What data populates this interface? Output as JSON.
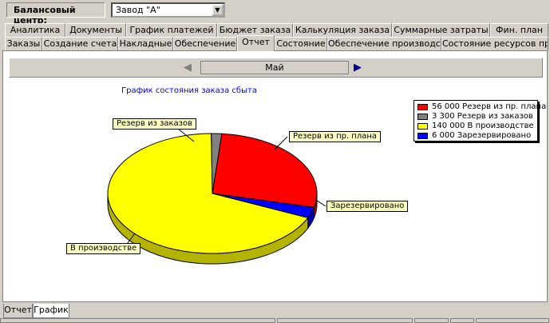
{
  "header": {
    "balance_center_label": "Балансовый центр:",
    "balance_center_value": "Завод \"А\""
  },
  "tabs_row1": [
    "Аналитика",
    "Документы",
    "График платежей",
    "Бюджет заказа",
    "Калькуляция заказа",
    "Суммарные затраты",
    "Фин. план"
  ],
  "tabs_row2": [
    "Заказы",
    "Создание счета",
    "Накладные",
    "Обеспечение",
    "Отчет",
    "Состояние",
    "Обеспечение производства",
    "Состояние ресурсов пр-ва"
  ],
  "active_tab": "Отчет",
  "nav": {
    "month": "Май",
    "prev_icon": "arrow-left-icon",
    "next_icon": "arrow-right-icon"
  },
  "chart_data": {
    "type": "pie",
    "title": "График состояния заказа сбыта",
    "slices": [
      {
        "label": "Резерв из пр. плана",
        "value": 56000,
        "color": "#ff0000"
      },
      {
        "label": "Зарезервировано",
        "value": 6000,
        "color": "#0000ff"
      },
      {
        "label": "В производстве",
        "value": 140000,
        "color": "#ffff00"
      },
      {
        "label": "Резерв из заказов",
        "value": 3300,
        "color": "#808080"
      }
    ],
    "legend": [
      {
        "text": "56 000 Резерв из пр. плана",
        "color": "#ff0000"
      },
      {
        "text": "3 300 Резерв из заказов",
        "color": "#808080"
      },
      {
        "text": "140 000 В производстве",
        "color": "#ffff00"
      },
      {
        "text": "6 000 Зарезервировано",
        "color": "#0000ff"
      }
    ],
    "legend_position": "top-right",
    "three_d": true
  },
  "bottom_tabs": [
    "Отчет",
    "График"
  ],
  "active_bottom_tab": "График"
}
